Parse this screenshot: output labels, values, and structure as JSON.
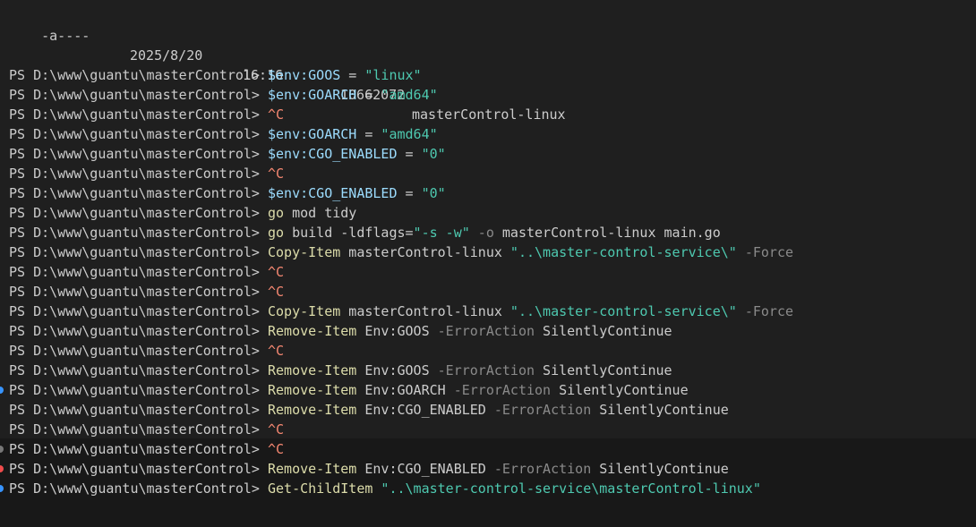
{
  "header": {
    "mode": "-a----",
    "date": "2025/8/20",
    "time": "16:16",
    "length": "10662072",
    "name": "masterControl-linux"
  },
  "prompt": "PS D:\\www\\guantu\\masterControl> ",
  "colors": {
    "background": "#1f1f1f",
    "highlight_band": "#181818",
    "command": "#dcdcaa",
    "variable": "#9cdcfe",
    "string": "#4ec9b0",
    "parameter": "#8a8a8a",
    "interrupt": "#f48771",
    "default": "#cccccc",
    "decoration_success": "#3794ff",
    "decoration_error": "#f14c4c",
    "decoration_neutral": "#777777"
  },
  "lines": [
    {
      "deco": null,
      "tokens": [
        [
          "var",
          "$env:GOOS"
        ],
        [
          "op",
          " = "
        ],
        [
          "str",
          "\"linux\""
        ]
      ]
    },
    {
      "deco": null,
      "tokens": [
        [
          "var",
          "$env:GOARCH"
        ],
        [
          "op",
          " = "
        ],
        [
          "str",
          "\"amd64\""
        ]
      ]
    },
    {
      "deco": null,
      "tokens": [
        [
          "interrupt",
          "^C"
        ]
      ]
    },
    {
      "deco": null,
      "tokens": [
        [
          "var",
          "$env:GOARCH"
        ],
        [
          "op",
          " = "
        ],
        [
          "str",
          "\"amd64\""
        ]
      ]
    },
    {
      "deco": null,
      "tokens": [
        [
          "var",
          "$env:CGO_ENABLED"
        ],
        [
          "op",
          " = "
        ],
        [
          "str",
          "\"0\""
        ]
      ]
    },
    {
      "deco": null,
      "tokens": [
        [
          "interrupt",
          "^C"
        ]
      ]
    },
    {
      "deco": null,
      "tokens": [
        [
          "var",
          "$env:CGO_ENABLED"
        ],
        [
          "op",
          " = "
        ],
        [
          "str",
          "\"0\""
        ]
      ]
    },
    {
      "deco": null,
      "tokens": [
        [
          "cmd",
          "go"
        ],
        [
          "arg",
          " mod tidy"
        ]
      ]
    },
    {
      "deco": null,
      "tokens": [
        [
          "cmd",
          "go"
        ],
        [
          "arg",
          " build -ldflags="
        ],
        [
          "str",
          "\"-s -w\""
        ],
        [
          "param",
          " -o"
        ],
        [
          "arg",
          " masterControl-linux main.go"
        ]
      ]
    },
    {
      "deco": null,
      "tokens": [
        [
          "cmd",
          "Copy-Item"
        ],
        [
          "arg",
          " masterControl-linux "
        ],
        [
          "str",
          "\"..\\master-control-service\\\""
        ],
        [
          "param",
          " -Force"
        ]
      ]
    },
    {
      "deco": null,
      "tokens": [
        [
          "interrupt",
          "^C"
        ]
      ]
    },
    {
      "deco": null,
      "tokens": [
        [
          "interrupt",
          "^C"
        ]
      ]
    },
    {
      "deco": null,
      "tokens": [
        [
          "cmd",
          "Copy-Item"
        ],
        [
          "arg",
          " masterControl-linux "
        ],
        [
          "str",
          "\"..\\master-control-service\\\""
        ],
        [
          "param",
          " -Force"
        ]
      ]
    },
    {
      "deco": null,
      "tokens": [
        [
          "cmd",
          "Remove-Item"
        ],
        [
          "arg",
          " Env:GOOS "
        ],
        [
          "param",
          "-ErrorAction"
        ],
        [
          "arg",
          " SilentlyContinue"
        ]
      ]
    },
    {
      "deco": null,
      "tokens": [
        [
          "interrupt",
          "^C"
        ]
      ]
    },
    {
      "deco": null,
      "tokens": [
        [
          "cmd",
          "Remove-Item"
        ],
        [
          "arg",
          " Env:GOOS "
        ],
        [
          "param",
          "-ErrorAction"
        ],
        [
          "arg",
          " SilentlyContinue"
        ]
      ]
    },
    {
      "deco": "blue",
      "tokens": [
        [
          "cmd",
          "Remove-Item"
        ],
        [
          "arg",
          " Env:GOARCH "
        ],
        [
          "param",
          "-ErrorAction"
        ],
        [
          "arg",
          " SilentlyContinue"
        ]
      ]
    },
    {
      "deco": null,
      "tokens": [
        [
          "cmd",
          "Remove-Item"
        ],
        [
          "arg",
          " Env:CGO_ENABLED "
        ],
        [
          "param",
          "-ErrorAction"
        ],
        [
          "arg",
          " SilentlyContinue"
        ]
      ]
    },
    {
      "deco": null,
      "tokens": [
        [
          "interrupt",
          "^C"
        ]
      ]
    },
    {
      "deco": "gray",
      "tokens": [
        [
          "interrupt",
          "^C"
        ]
      ]
    },
    {
      "deco": "red",
      "tokens": [
        [
          "cmd",
          "Remove-Item"
        ],
        [
          "arg",
          " Env:CGO_ENABLED "
        ],
        [
          "param",
          "-ErrorAction"
        ],
        [
          "arg",
          " SilentlyContinue"
        ]
      ]
    },
    {
      "deco": "blue",
      "tokens": [
        [
          "cmd",
          "Get-ChildItem"
        ],
        [
          "arg",
          " "
        ],
        [
          "str",
          "\"..\\master-control-service\\masterControl-linux\""
        ]
      ]
    }
  ]
}
